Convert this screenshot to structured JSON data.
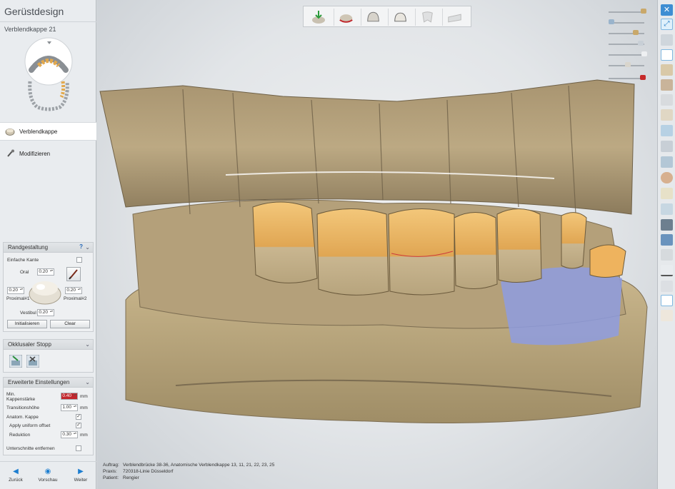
{
  "app": {
    "title": "Gerüstdesign",
    "subtitle": "Verblendkappe 21"
  },
  "steps": [
    {
      "label": "Verblendkappe",
      "active": true
    },
    {
      "label": "Modifizieren",
      "active": false
    }
  ],
  "randgestaltung": {
    "title": "Randgestaltung",
    "help": "?",
    "einfache_kante": "Einfache Kante",
    "oral_label": "Oral",
    "oral_value": "0.20",
    "proximal1_label": "Proximal#1",
    "proximal1_value": "0.20",
    "proximal2_label": "Proximal#2",
    "proximal2_value": "0.20",
    "vestibul_label": "Vestibul",
    "vestibul_value": "0.20",
    "init_button": "Initialisieren",
    "clear_button": "Clear"
  },
  "okklusaler_stopp": {
    "title": "Okklusaler Stopp"
  },
  "erweiterte": {
    "title": "Erweiterte Einstellungen",
    "min_kappe_label_1": "Min.",
    "min_kappe_label_2": "Kappenstärke",
    "min_kappe_value": "0.40",
    "transition_label": "Transitionshöhe",
    "transition_value": "1.00",
    "anatom_label": "Anatom. Kappe",
    "uniform_label": "Apply uniform offset",
    "reduktion_label": "Reduktion",
    "reduktion_value": "0.30",
    "unterschnitte_label": "Unterschnitte entfernen",
    "unit": "mm"
  },
  "nav": {
    "back": "Zurück",
    "preview": "Vorschau",
    "next": "Weiter"
  },
  "info": {
    "auftrag_key": "Auftrag:",
    "auftrag_val": "Verblendbrücke 38-36, Anatomische Verblendkappe 13, 11, 21, 22, 23, 25",
    "praxis_key": "Praxis:",
    "praxis_val": "720318-Linie Düsseldorf",
    "patient_key": "Patient:",
    "patient_val": "Rengier"
  },
  "colors": {
    "accent": "#1d7ed0",
    "min_kappe_bg": "#c2272d",
    "model": "#b9a57c",
    "tooth": "#e7b463",
    "jaw_mesh": "#8e9ce0"
  }
}
